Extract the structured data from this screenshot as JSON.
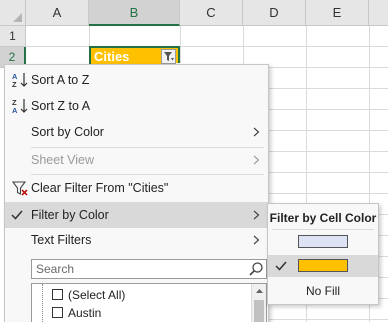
{
  "sheet": {
    "columns": [
      "A",
      "B",
      "C",
      "D",
      "E"
    ],
    "rows": [
      "1",
      "2"
    ],
    "cell_b2": "Cities",
    "header_fill": "#ffc000",
    "accent": "#217346"
  },
  "menu": {
    "sort_a_z": "Sort A to Z",
    "sort_z_a": "Sort Z to A",
    "sort_by_color": "Sort by Color",
    "sheet_view": "Sheet View",
    "clear_filter": "Clear Filter From \"Cities\"",
    "filter_by_color": "Filter by Color",
    "text_filters": "Text Filters",
    "search_placeholder": "Search",
    "list_items": [
      {
        "label": "(Select All)",
        "checked": false
      },
      {
        "label": "Austin",
        "checked": false
      }
    ]
  },
  "submenu": {
    "title": "Filter by Cell Color",
    "swatches": [
      {
        "color": "#dde3f5",
        "selected": false
      },
      {
        "color": "#ffc000",
        "selected": true
      }
    ],
    "no_fill": "No Fill"
  },
  "icons": {
    "sort_a_z": "sort-ascending-icon",
    "sort_z_a": "sort-descending-icon",
    "clear_filter": "clear-filter-icon",
    "filter_button": "filter-dropdown-icon",
    "search": "magnifier-icon",
    "submenu_arrow": "chevron-right-icon",
    "check": "checkmark-icon"
  }
}
